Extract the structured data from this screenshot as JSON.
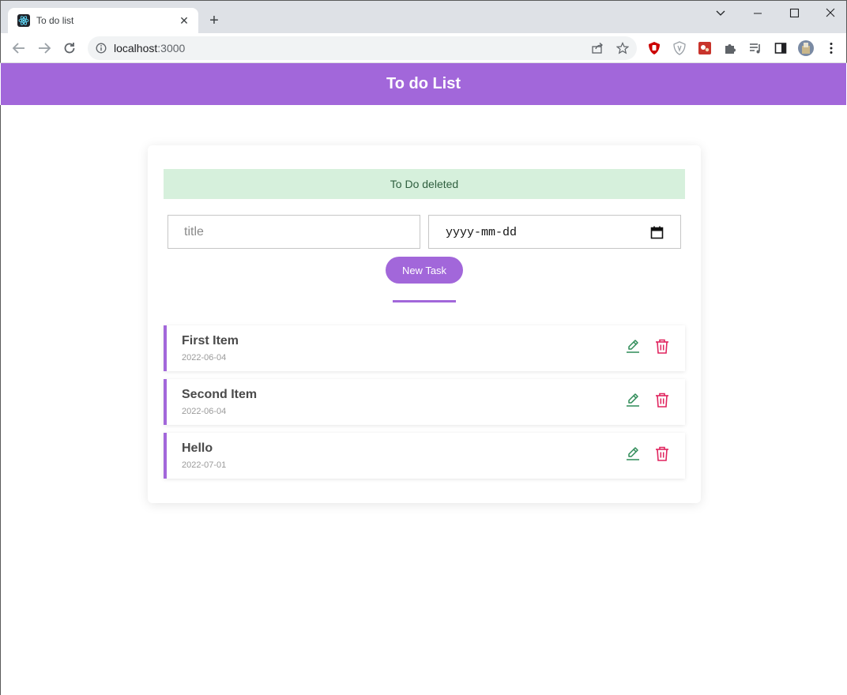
{
  "browser": {
    "tab_title": "To do list",
    "url_host": "localhost",
    "url_port": ":3000"
  },
  "app": {
    "title": "To do List",
    "accent_color": "#a267da"
  },
  "alert": {
    "message": "To Do deleted",
    "bg_color": "#d6f0dc"
  },
  "form": {
    "title_placeholder": "title",
    "date_placeholder": "yyyy-mm-dd",
    "submit_label": "New Task"
  },
  "tasks": [
    {
      "title": "First Item",
      "date": "2022-06-04"
    },
    {
      "title": "Second Item",
      "date": "2022-06-04"
    },
    {
      "title": "Hello",
      "date": "2022-07-01"
    }
  ],
  "icons": {
    "edit": "pencil-icon",
    "delete": "trash-icon",
    "edit_color": "#2e8b57",
    "delete_color": "#e0245e"
  }
}
